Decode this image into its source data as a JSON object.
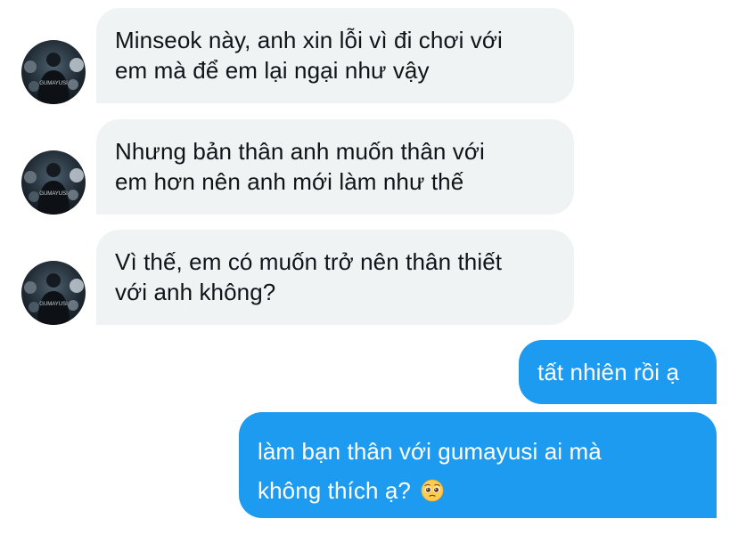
{
  "conversation": {
    "received": [
      {
        "lines": [
          "Minseok này, anh xin lỗi vì đi chơi với",
          "em mà để em lại ngại như vậy"
        ]
      },
      {
        "lines": [
          "Nhưng bản thân anh muốn thân với",
          "em hơn nên anh mới làm như thế"
        ]
      },
      {
        "lines": [
          "Vì thế, em có muốn trở nên thân thiết",
          "với anh không?"
        ]
      }
    ],
    "sent": [
      {
        "lines": [
          "tất nhiên rồi ạ"
        ]
      },
      {
        "lines": [
          "làm bạn thân với gumayusi ai mà",
          "không thích ạ?"
        ],
        "emoji": "pleading-face-emoji"
      }
    ],
    "avatar_caption": "GUMAYUSI"
  },
  "colors": {
    "received_bubble": "#eff3f4",
    "sent_bubble": "#1d9bf0",
    "text_dark": "#0f1419",
    "text_light": "#ffffff"
  }
}
